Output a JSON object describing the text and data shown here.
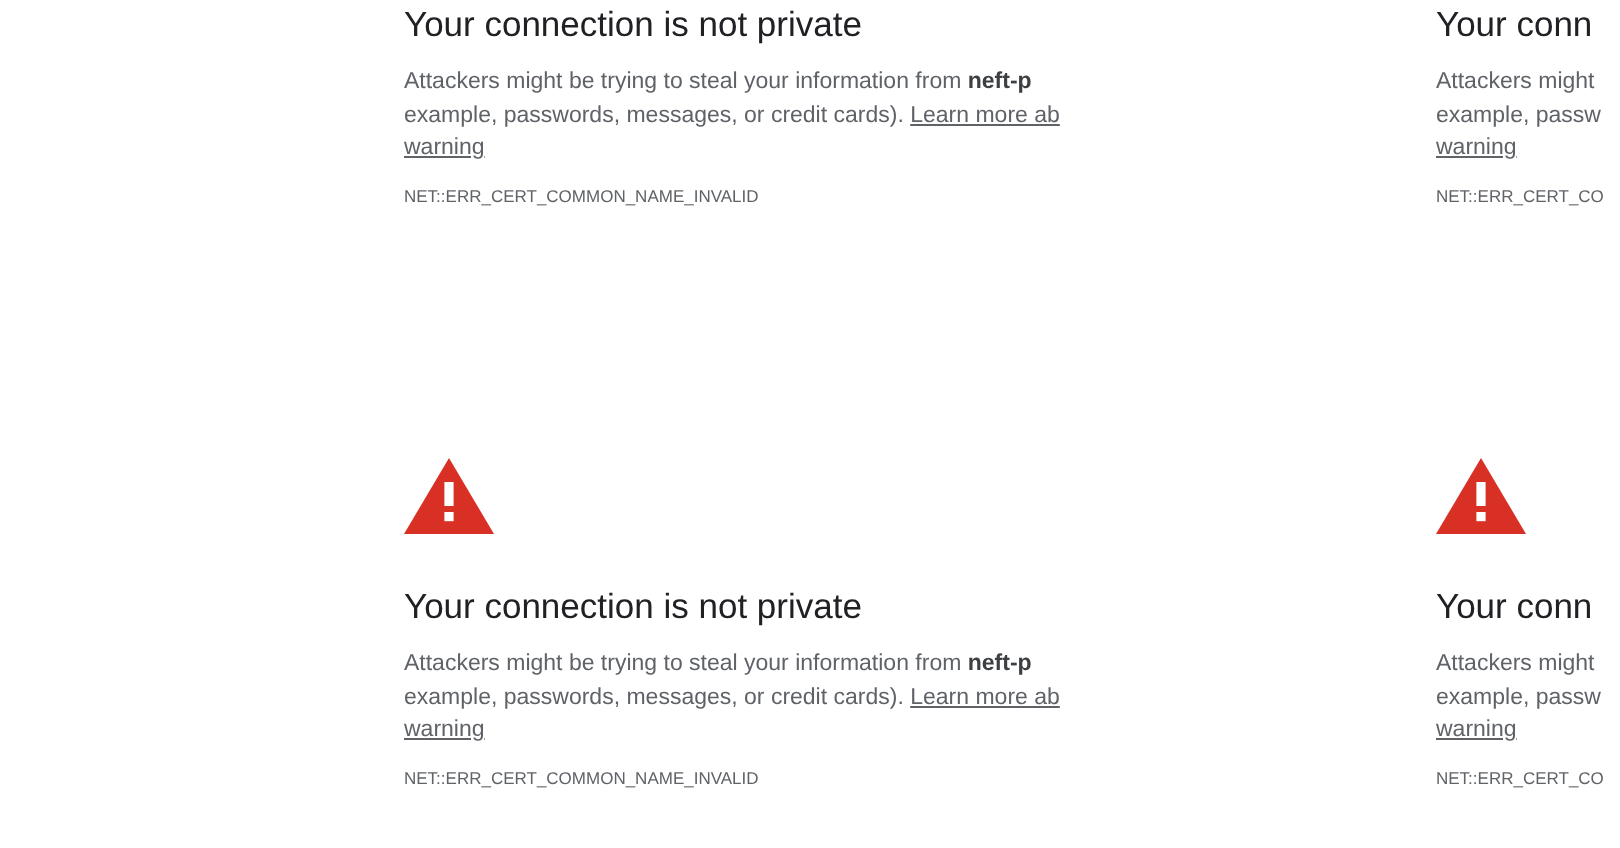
{
  "rows": [
    {
      "tiles": [
        {
          "title": "Your connection is not private",
          "lines": [
            {
              "text": "Attackers might be trying to steal your information from **neft-p**"
            },
            {
              "text": "example, passwords, messages, or credit cards).",
              "link": "Learn more ab"
            },
            {
              "link": "warning"
            }
          ],
          "error_code": "NET::ERR_CERT_COMMON_NAME_INVALID"
        },
        {
          "title": "Your conn",
          "lines": [
            {
              "text": "Attackers might"
            },
            {
              "text": "example, passw"
            },
            {
              "link": "warning"
            }
          ],
          "error_code": "NET::ERR_CERT_CO"
        }
      ]
    },
    {
      "tiles": [
        {
          "warning_icon": true,
          "title": "Your connection is not private",
          "lines": [
            {
              "text": "Attackers might be trying to steal your information from **neft-p**"
            },
            {
              "text": "example, passwords, messages, or credit cards).",
              "link": "Learn more ab"
            },
            {
              "link": "warning"
            }
          ],
          "error_code": "NET::ERR_CERT_COMMON_NAME_INVALID"
        },
        {
          "warning_icon": true,
          "title": "Your conn",
          "lines": [
            {
              "text": "Attackers might"
            },
            {
              "text": "example, passw"
            },
            {
              "link": "warning"
            }
          ],
          "error_code": "NET::ERR_CERT_CO"
        }
      ]
    }
  ]
}
